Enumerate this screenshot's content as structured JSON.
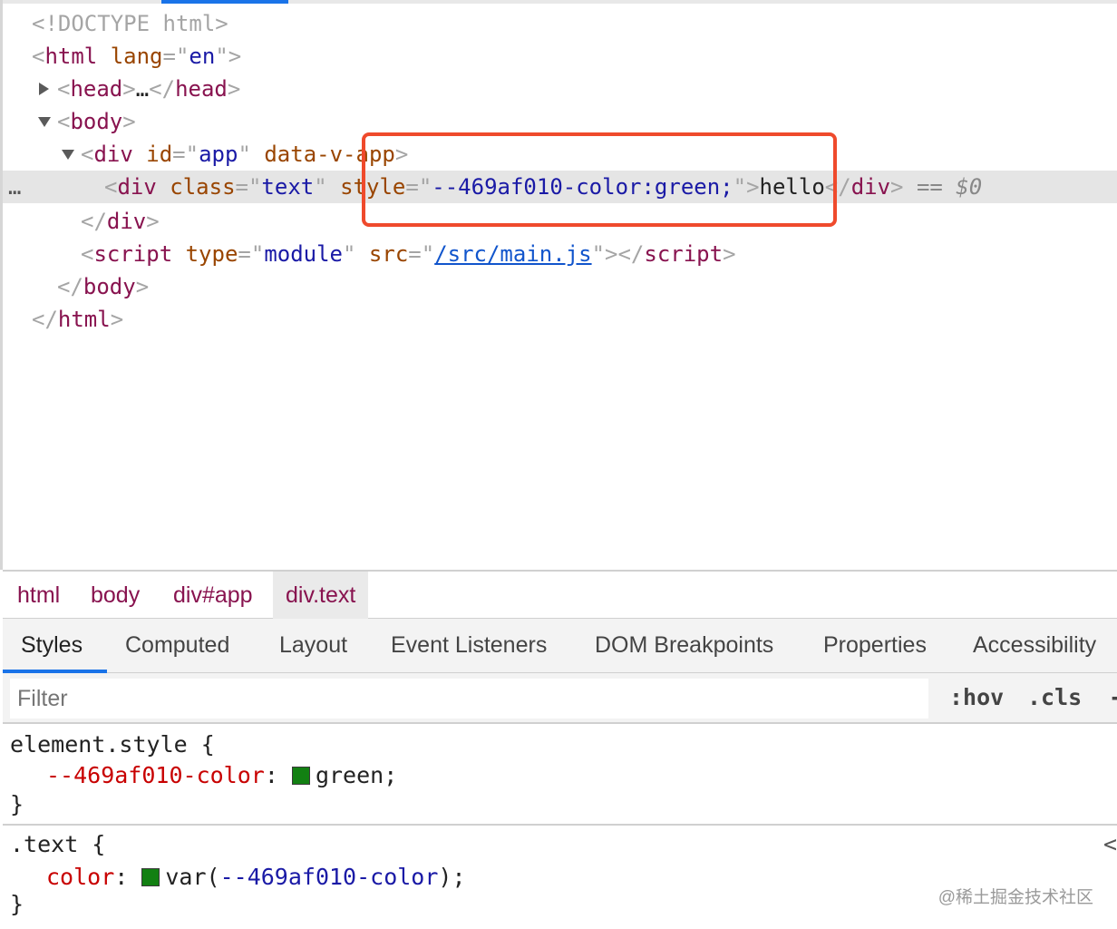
{
  "dom_tree": {
    "doctype": "<!DOCTYPE html>",
    "html_open_tag": "html",
    "html_lang_attr": "lang",
    "html_lang_value": "en",
    "head_tag": "head",
    "head_ellipsis": "…",
    "body_tag": "body",
    "app_div_tag": "div",
    "app_id_attr": "id",
    "app_id_value": "app",
    "app_data_attr": "data-v-app",
    "selected_div_tag": "div",
    "selected_class_attr": "class",
    "selected_class_value": "text",
    "selected_style_attr": "style",
    "selected_style_value": "--469af010-color:green;",
    "selected_text": "hello",
    "selected_marker": "== $0",
    "ellipsis": "…",
    "script_tag": "script",
    "script_type_attr": "type",
    "script_type_value": "module",
    "script_src_attr": "src",
    "script_src_value": "/src/main.js",
    "close_div": "div",
    "close_body": "body",
    "close_html": "html"
  },
  "breadcrumb": [
    "html",
    "body",
    "div#app",
    "div.text"
  ],
  "tabs": [
    "Styles",
    "Computed",
    "Layout",
    "Event Listeners",
    "DOM Breakpoints",
    "Properties",
    "Accessibility"
  ],
  "filter": {
    "placeholder": "Filter",
    "hov": ":hov",
    "cls": ".cls",
    "more": "-"
  },
  "rules": {
    "element_style": {
      "selector": "element.style {",
      "property": "--469af010-color",
      "value": "green;",
      "close": "}"
    },
    "text_rule": {
      "selector": ".text {",
      "property": "color",
      "value_func_open": "var(",
      "value_var": "--469af010-color",
      "value_func_close": ");",
      "close": "}",
      "source_glyph": "<"
    }
  },
  "colors": {
    "swatch": "#128012",
    "highlight": "#ef4a2c",
    "accent": "#1a73e8"
  },
  "watermark": "@稀土掘金技术社区"
}
